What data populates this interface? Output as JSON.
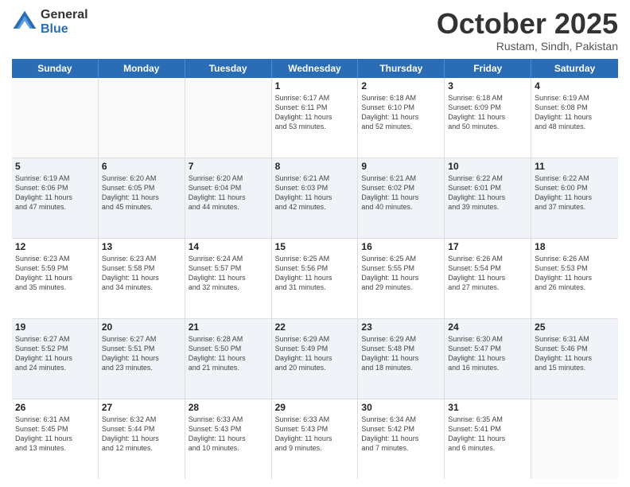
{
  "logo": {
    "general": "General",
    "blue": "Blue"
  },
  "header": {
    "month": "October 2025",
    "location": "Rustam, Sindh, Pakistan"
  },
  "weekdays": [
    "Sunday",
    "Monday",
    "Tuesday",
    "Wednesday",
    "Thursday",
    "Friday",
    "Saturday"
  ],
  "rows": [
    [
      {
        "day": "",
        "info": ""
      },
      {
        "day": "",
        "info": ""
      },
      {
        "day": "",
        "info": ""
      },
      {
        "day": "1",
        "info": "Sunrise: 6:17 AM\nSunset: 6:11 PM\nDaylight: 11 hours\nand 53 minutes."
      },
      {
        "day": "2",
        "info": "Sunrise: 6:18 AM\nSunset: 6:10 PM\nDaylight: 11 hours\nand 52 minutes."
      },
      {
        "day": "3",
        "info": "Sunrise: 6:18 AM\nSunset: 6:09 PM\nDaylight: 11 hours\nand 50 minutes."
      },
      {
        "day": "4",
        "info": "Sunrise: 6:19 AM\nSunset: 6:08 PM\nDaylight: 11 hours\nand 48 minutes."
      }
    ],
    [
      {
        "day": "5",
        "info": "Sunrise: 6:19 AM\nSunset: 6:06 PM\nDaylight: 11 hours\nand 47 minutes."
      },
      {
        "day": "6",
        "info": "Sunrise: 6:20 AM\nSunset: 6:05 PM\nDaylight: 11 hours\nand 45 minutes."
      },
      {
        "day": "7",
        "info": "Sunrise: 6:20 AM\nSunset: 6:04 PM\nDaylight: 11 hours\nand 44 minutes."
      },
      {
        "day": "8",
        "info": "Sunrise: 6:21 AM\nSunset: 6:03 PM\nDaylight: 11 hours\nand 42 minutes."
      },
      {
        "day": "9",
        "info": "Sunrise: 6:21 AM\nSunset: 6:02 PM\nDaylight: 11 hours\nand 40 minutes."
      },
      {
        "day": "10",
        "info": "Sunrise: 6:22 AM\nSunset: 6:01 PM\nDaylight: 11 hours\nand 39 minutes."
      },
      {
        "day": "11",
        "info": "Sunrise: 6:22 AM\nSunset: 6:00 PM\nDaylight: 11 hours\nand 37 minutes."
      }
    ],
    [
      {
        "day": "12",
        "info": "Sunrise: 6:23 AM\nSunset: 5:59 PM\nDaylight: 11 hours\nand 35 minutes."
      },
      {
        "day": "13",
        "info": "Sunrise: 6:23 AM\nSunset: 5:58 PM\nDaylight: 11 hours\nand 34 minutes."
      },
      {
        "day": "14",
        "info": "Sunrise: 6:24 AM\nSunset: 5:57 PM\nDaylight: 11 hours\nand 32 minutes."
      },
      {
        "day": "15",
        "info": "Sunrise: 6:25 AM\nSunset: 5:56 PM\nDaylight: 11 hours\nand 31 minutes."
      },
      {
        "day": "16",
        "info": "Sunrise: 6:25 AM\nSunset: 5:55 PM\nDaylight: 11 hours\nand 29 minutes."
      },
      {
        "day": "17",
        "info": "Sunrise: 6:26 AM\nSunset: 5:54 PM\nDaylight: 11 hours\nand 27 minutes."
      },
      {
        "day": "18",
        "info": "Sunrise: 6:26 AM\nSunset: 5:53 PM\nDaylight: 11 hours\nand 26 minutes."
      }
    ],
    [
      {
        "day": "19",
        "info": "Sunrise: 6:27 AM\nSunset: 5:52 PM\nDaylight: 11 hours\nand 24 minutes."
      },
      {
        "day": "20",
        "info": "Sunrise: 6:27 AM\nSunset: 5:51 PM\nDaylight: 11 hours\nand 23 minutes."
      },
      {
        "day": "21",
        "info": "Sunrise: 6:28 AM\nSunset: 5:50 PM\nDaylight: 11 hours\nand 21 minutes."
      },
      {
        "day": "22",
        "info": "Sunrise: 6:29 AM\nSunset: 5:49 PM\nDaylight: 11 hours\nand 20 minutes."
      },
      {
        "day": "23",
        "info": "Sunrise: 6:29 AM\nSunset: 5:48 PM\nDaylight: 11 hours\nand 18 minutes."
      },
      {
        "day": "24",
        "info": "Sunrise: 6:30 AM\nSunset: 5:47 PM\nDaylight: 11 hours\nand 16 minutes."
      },
      {
        "day": "25",
        "info": "Sunrise: 6:31 AM\nSunset: 5:46 PM\nDaylight: 11 hours\nand 15 minutes."
      }
    ],
    [
      {
        "day": "26",
        "info": "Sunrise: 6:31 AM\nSunset: 5:45 PM\nDaylight: 11 hours\nand 13 minutes."
      },
      {
        "day": "27",
        "info": "Sunrise: 6:32 AM\nSunset: 5:44 PM\nDaylight: 11 hours\nand 12 minutes."
      },
      {
        "day": "28",
        "info": "Sunrise: 6:33 AM\nSunset: 5:43 PM\nDaylight: 11 hours\nand 10 minutes."
      },
      {
        "day": "29",
        "info": "Sunrise: 6:33 AM\nSunset: 5:43 PM\nDaylight: 11 hours\nand 9 minutes."
      },
      {
        "day": "30",
        "info": "Sunrise: 6:34 AM\nSunset: 5:42 PM\nDaylight: 11 hours\nand 7 minutes."
      },
      {
        "day": "31",
        "info": "Sunrise: 6:35 AM\nSunset: 5:41 PM\nDaylight: 11 hours\nand 6 minutes."
      },
      {
        "day": "",
        "info": ""
      }
    ]
  ]
}
